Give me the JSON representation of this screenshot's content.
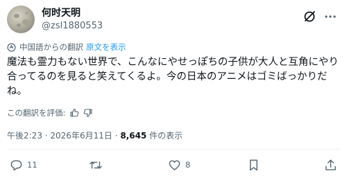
{
  "author": {
    "display_name": "何时天明",
    "handle": "@zsl1880553"
  },
  "translation": {
    "notice": "中国語からの翻訳",
    "show_original": "原文を表示"
  },
  "tweet": {
    "text": "魔法も霊力もない世界で、こんなにやせっぽちの子供が大人と互角にやり合ってるのを見ると笑えてくるよ。今の日本のアニメはゴミばっかりだね。"
  },
  "rating": {
    "label": "この翻訳を評価:"
  },
  "meta": {
    "time": "午後2:23",
    "separator1": " · ",
    "date": "2026年6月11日",
    "separator2": " · ",
    "views": "8,645",
    "views_label": " 件の表示"
  },
  "actions": {
    "replies": "11",
    "retweets": "",
    "likes": "8"
  },
  "colors": {
    "accent": "#1d9bf0",
    "secondary_text": "#536471",
    "primary_text": "#0f1419"
  }
}
